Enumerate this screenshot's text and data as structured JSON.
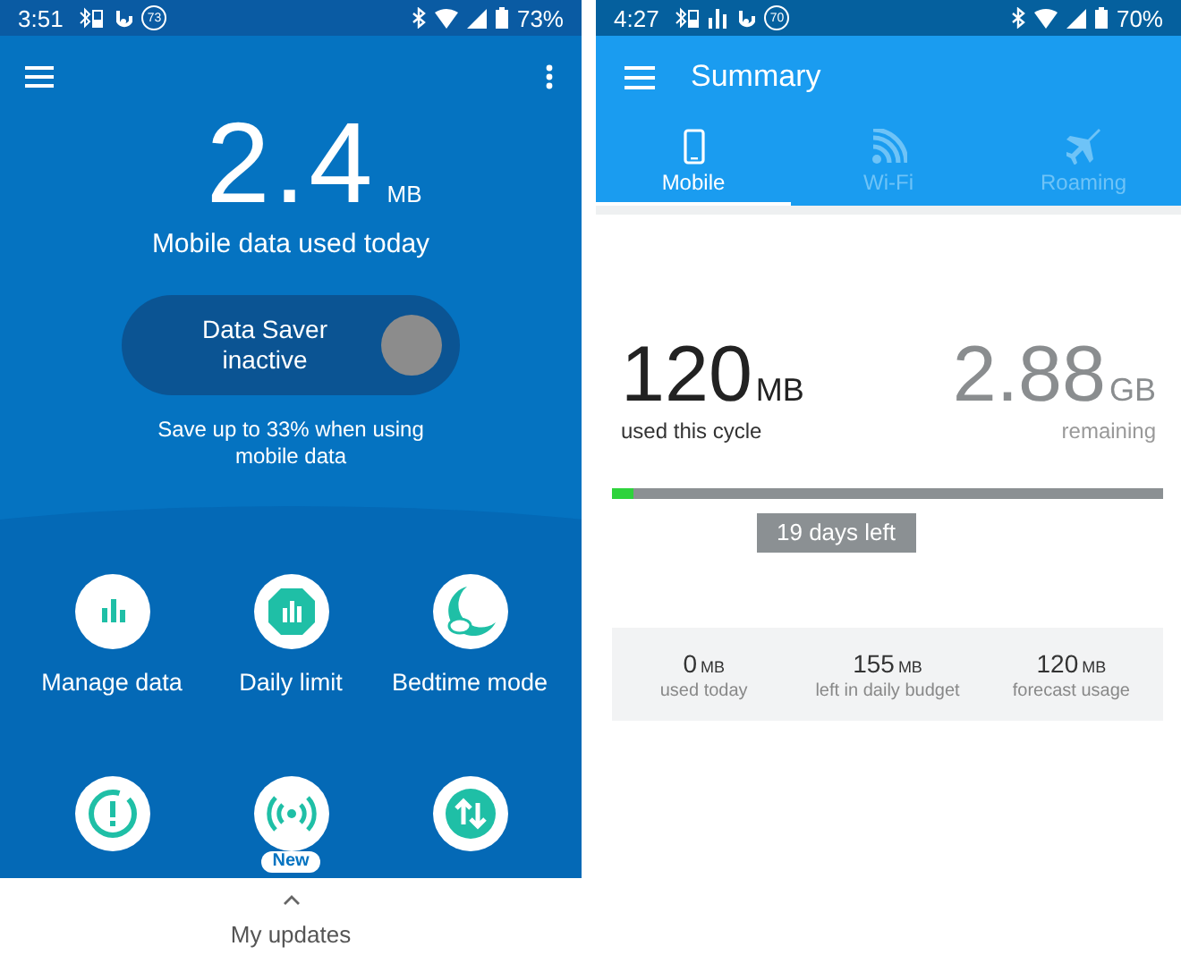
{
  "left_screen": {
    "status_bar": {
      "time": "3:51",
      "badge": "73",
      "battery": "73%"
    },
    "usage": {
      "value": "2.4",
      "unit": "MB",
      "caption": "Mobile data used today"
    },
    "data_saver": {
      "label": "Data Saver inactive",
      "on": false,
      "note": "Save up to 33% when using mobile data"
    },
    "shortcuts": [
      {
        "kind": "bars",
        "label": "Manage data"
      },
      {
        "kind": "limit",
        "label": "Daily limit"
      },
      {
        "kind": "moon",
        "label": "Bedtime mode"
      },
      {
        "kind": "alert"
      },
      {
        "kind": "broadcast",
        "badge": "New"
      },
      {
        "kind": "transfer"
      }
    ],
    "bottom_sheet": {
      "label": "My updates"
    }
  },
  "right_screen": {
    "status_bar": {
      "time": "4:27",
      "badge": "70",
      "battery": "70%"
    },
    "app_bar": {
      "title": "Summary"
    },
    "tabs": [
      {
        "kind": "phone",
        "label": "Mobile",
        "selected": true
      },
      {
        "kind": "wifi",
        "label": "Wi-Fi",
        "selected": false
      },
      {
        "kind": "plane",
        "label": "Roaming",
        "selected": false
      }
    ],
    "used": {
      "value": "120",
      "unit": "MB",
      "caption": "used this cycle"
    },
    "remaining": {
      "value": "2.88",
      "unit": "GB",
      "caption": "remaining"
    },
    "cycle_bar": {
      "level": 0.04,
      "label": "19 days left"
    },
    "stats": [
      {
        "value": "0",
        "unit": "MB",
        "caption": "used today"
      },
      {
        "value": "155",
        "unit": "MB",
        "caption": "left in daily budget"
      },
      {
        "value": "120",
        "unit": "MB",
        "caption": "forecast usage"
      }
    ]
  }
}
